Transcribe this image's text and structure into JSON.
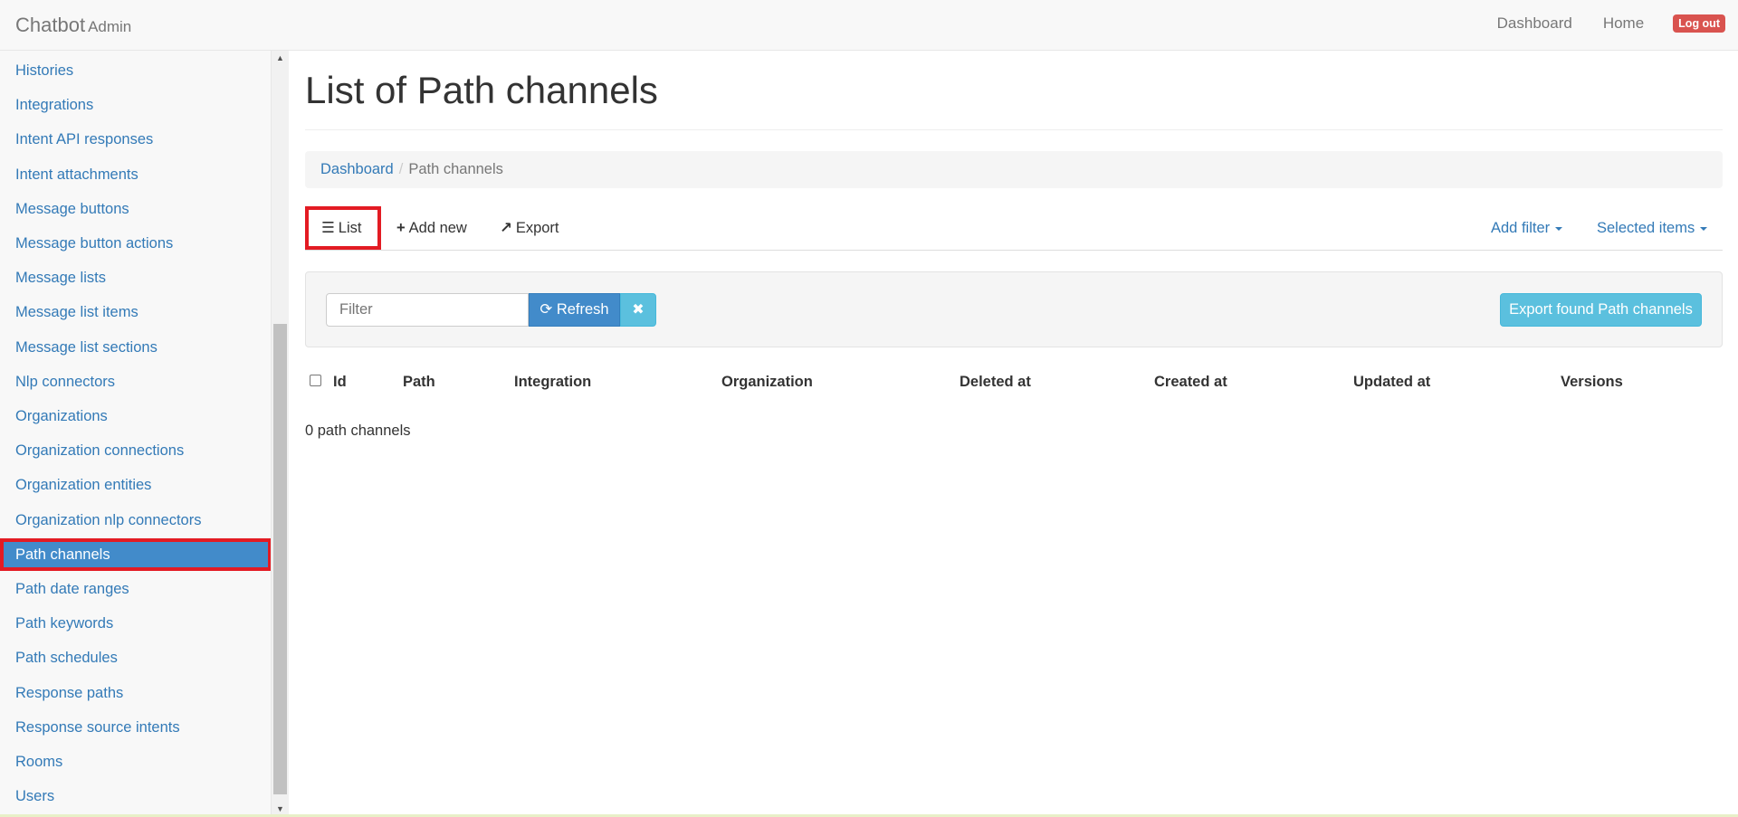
{
  "brand": {
    "title": "Chatbot",
    "subtitle": "Admin"
  },
  "topnav": {
    "dashboard": "Dashboard",
    "home": "Home",
    "logout": "Log out"
  },
  "sidebar": {
    "items": [
      {
        "label": "Histories"
      },
      {
        "label": "Integrations"
      },
      {
        "label": "Intent API responses"
      },
      {
        "label": "Intent attachments"
      },
      {
        "label": "Message buttons"
      },
      {
        "label": "Message button actions"
      },
      {
        "label": "Message lists"
      },
      {
        "label": "Message list items"
      },
      {
        "label": "Message list sections"
      },
      {
        "label": "Nlp connectors"
      },
      {
        "label": "Organizations"
      },
      {
        "label": "Organization connections"
      },
      {
        "label": "Organization entities"
      },
      {
        "label": "Organization nlp connectors"
      },
      {
        "label": "Path channels"
      },
      {
        "label": "Path date ranges"
      },
      {
        "label": "Path keywords"
      },
      {
        "label": "Path schedules"
      },
      {
        "label": "Response paths"
      },
      {
        "label": "Response source intents"
      },
      {
        "label": "Rooms"
      },
      {
        "label": "Users"
      }
    ],
    "active": "Path channels"
  },
  "page": {
    "title": "List of Path channels"
  },
  "breadcrumb": {
    "home": "Dashboard",
    "current": "Path channels"
  },
  "tabs": {
    "list": "List",
    "add_new": "Add new",
    "export": "Export",
    "add_filter": "Add filter",
    "selected_items": "Selected items"
  },
  "filter": {
    "placeholder": "Filter",
    "refresh": "Refresh",
    "export_found": "Export found Path channels"
  },
  "table": {
    "columns": [
      "Id",
      "Path",
      "Integration",
      "Organization",
      "Deleted at",
      "Created at",
      "Updated at",
      "Versions"
    ],
    "count_text": "0 path channels"
  },
  "colors": {
    "link": "#337ab7",
    "active_bg": "#428bca",
    "highlight": "#e31b23",
    "logout": "#d9534f",
    "info": "#5bc0de"
  }
}
